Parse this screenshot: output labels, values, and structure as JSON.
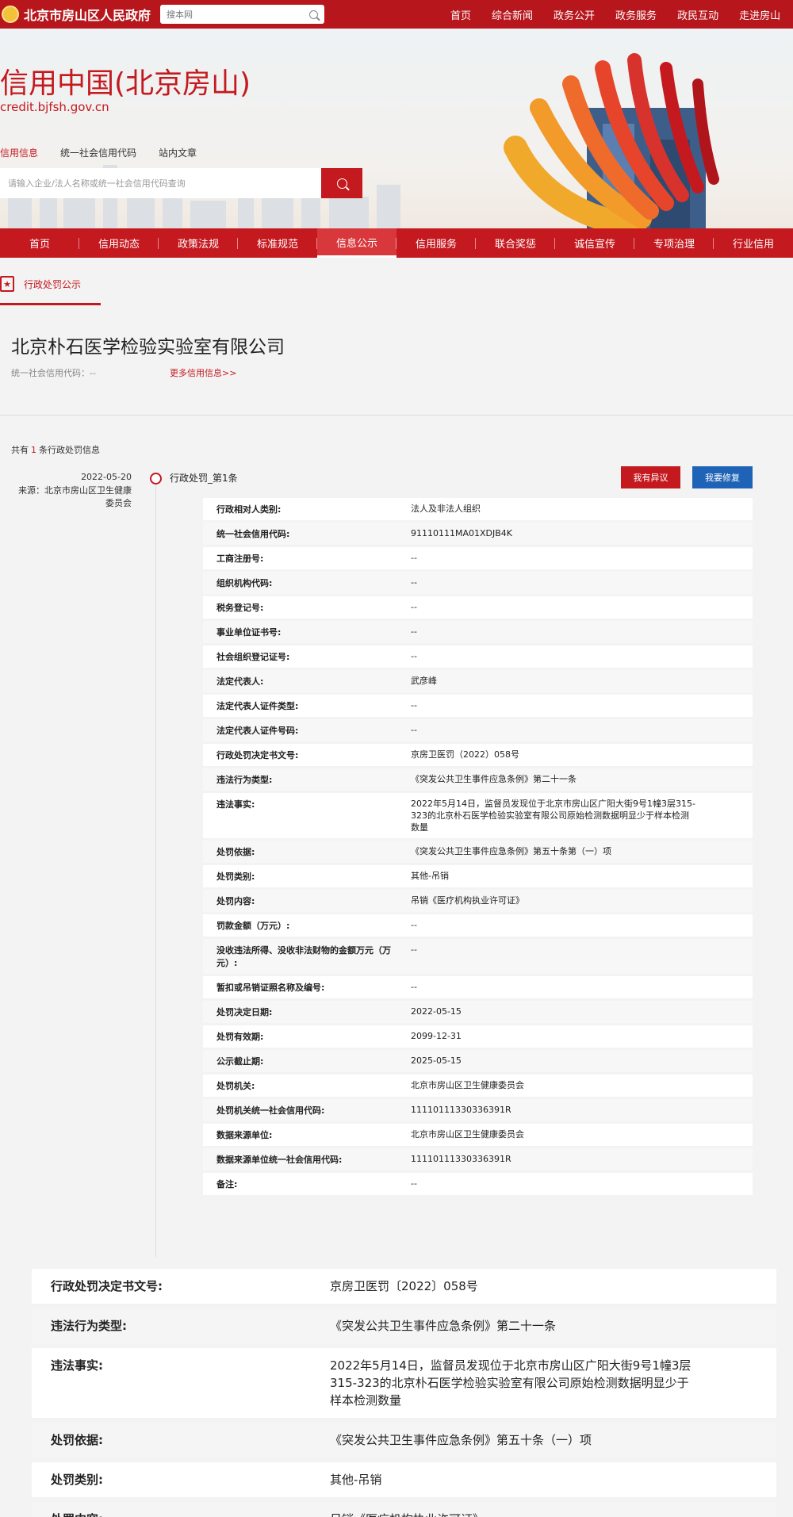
{
  "topbar": {
    "site_name": "北京市房山区人民政府",
    "search_placeholder": "搜本网",
    "nav": [
      "首页",
      "综合新闻",
      "政务公开",
      "政务服务",
      "政民互动",
      "走进房山"
    ]
  },
  "banner": {
    "title": "信用中国(北京房山)",
    "url": "credit.bjfsh.gov.cn",
    "tabs": [
      "信用信息",
      "统一社会信用代码",
      "站内文章"
    ],
    "search_placeholder": "请输入企业/法人名称或统一社会信用代码查询"
  },
  "main_nav": [
    "首页",
    "信用动态",
    "政策法规",
    "标准规范",
    "信息公示",
    "信用服务",
    "联合奖惩",
    "诚信宣传",
    "专项治理",
    "行业信用"
  ],
  "main_nav_active": 4,
  "section": {
    "title": "行政处罚公示"
  },
  "company": {
    "name": "北京朴石医学检验实验室有限公司",
    "credit_code_label": "统一社会信用代码：--",
    "more_link": "更多信用信息>>"
  },
  "summary": {
    "prefix": "共有",
    "count": "1",
    "suffix": "条行政处罚信息"
  },
  "record": {
    "date": "2022-05-20",
    "source": "来源：北京市房山区卫生健康委员会",
    "title": "行政处罚_第1条",
    "objection_button": "我有异议",
    "repair_button": "我要修复",
    "rows": [
      {
        "k": "行政相对人类别:",
        "v": "法人及非法人组织"
      },
      {
        "k": "统一社会信用代码:",
        "v": "91110111MA01XDJB4K"
      },
      {
        "k": "工商注册号:",
        "v": "--"
      },
      {
        "k": "组织机构代码:",
        "v": "--"
      },
      {
        "k": "税务登记号:",
        "v": "--"
      },
      {
        "k": "事业单位证书号:",
        "v": "--"
      },
      {
        "k": "社会组织登记证号:",
        "v": "--"
      },
      {
        "k": "法定代表人:",
        "v": "武彦峰"
      },
      {
        "k": "法定代表人证件类型:",
        "v": "--"
      },
      {
        "k": "法定代表人证件号码:",
        "v": "--"
      },
      {
        "k": "行政处罚决定书文号:",
        "v": "京房卫医罚（2022）058号"
      },
      {
        "k": "违法行为类型:",
        "v": "《突发公共卫生事件应急条例》第二十一条"
      },
      {
        "k": "违法事实:",
        "v": "2022年5月14日，监督员发现位于北京市房山区广阳大街9号1幢3层315-323的北京朴石医学检验实验室有限公司原始检测数据明显少于样本检测数量"
      },
      {
        "k": "处罚依据:",
        "v": "《突发公共卫生事件应急条例》第五十条第（一）项"
      },
      {
        "k": "处罚类别:",
        "v": "其他-吊销"
      },
      {
        "k": "处罚内容:",
        "v": "吊销《医疗机构执业许可证》"
      },
      {
        "k": "罚款金额（万元）:",
        "v": "--"
      },
      {
        "k": "没收违法所得、没收非法财物的金额万元（万元）:",
        "v": "--"
      },
      {
        "k": "暂扣或吊销证照名称及编号:",
        "v": "--"
      },
      {
        "k": "处罚决定日期:",
        "v": "2022-05-15"
      },
      {
        "k": "处罚有效期:",
        "v": "2099-12-31"
      },
      {
        "k": "公示截止期:",
        "v": "2025-05-15"
      },
      {
        "k": "处罚机关:",
        "v": "北京市房山区卫生健康委员会"
      },
      {
        "k": "处罚机关统一社会信用代码:",
        "v": "11110111330336391R"
      },
      {
        "k": "数据来源单位:",
        "v": "北京市房山区卫生健康委员会"
      },
      {
        "k": "数据来源单位统一社会信用代码:",
        "v": "11110111330336391R"
      },
      {
        "k": "备注:",
        "v": "--"
      }
    ]
  },
  "zoom_rows": [
    {
      "k": "行政处罚决定书文号:",
      "v": "京房卫医罚〔2022〕058号"
    },
    {
      "k": "违法行为类型:",
      "v": "《突发公共卫生事件应急条例》第二十一条"
    },
    {
      "k": "违法事实:",
      "v": "2022年5月14日，监督员发现位于北京市房山区广阳大街9号1幢3层315-323的北京朴石医学检验实验室有限公司原始检测数据明显少于样本检测数量"
    },
    {
      "k": "处罚依据:",
      "v": "《突发公共卫生事件应急条例》第五十条（一）项"
    },
    {
      "k": "处罚类别:",
      "v": "其他-吊销"
    },
    {
      "k": "处罚内容:",
      "v": "吊销《医疗机构执业许可证》"
    }
  ],
  "colors": {
    "brand_red": "#c4191f",
    "repair_blue": "#1f63b6"
  }
}
